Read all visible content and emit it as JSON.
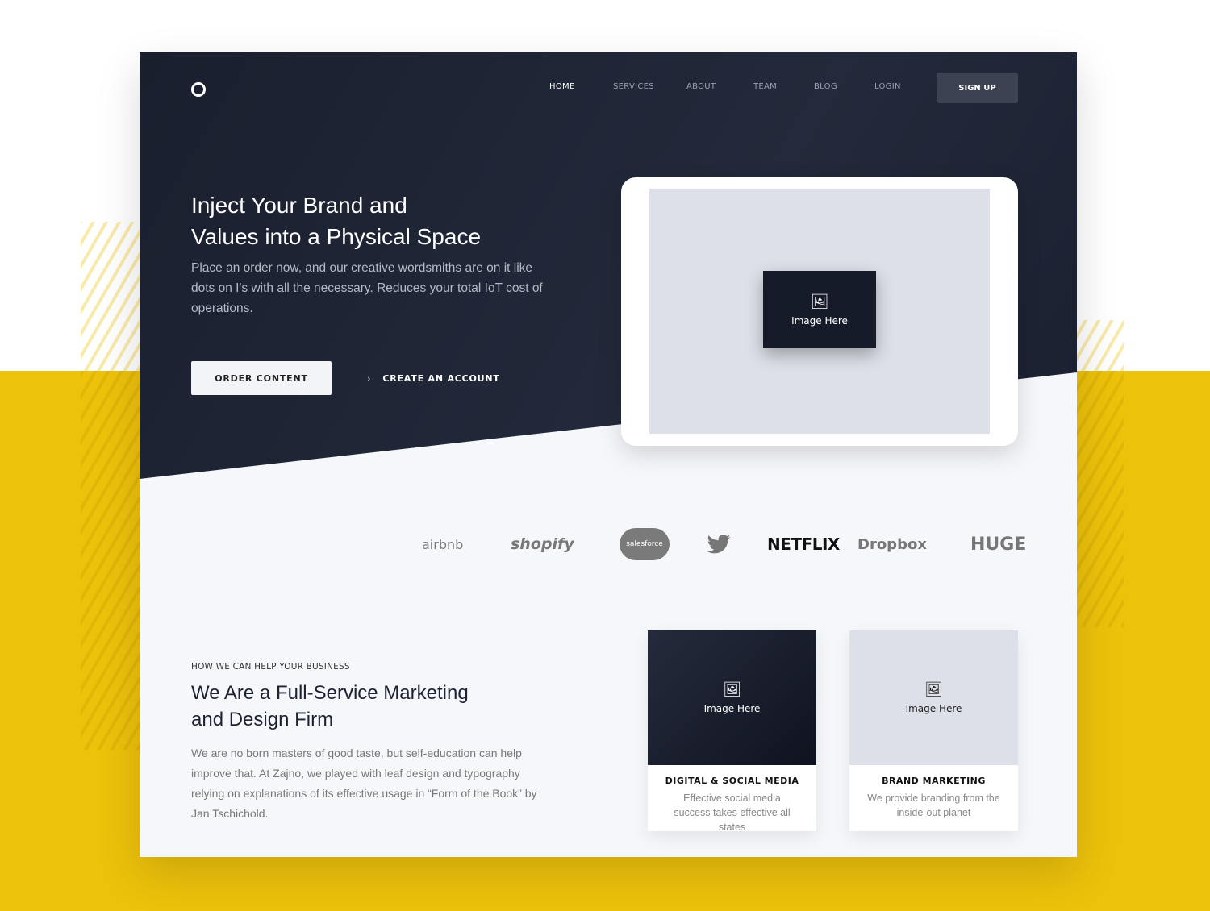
{
  "nav": {
    "items": [
      "HOME",
      "SERVICES",
      "ABOUT",
      "TEAM",
      "BLOG",
      "LOGIN"
    ],
    "signup": "SIGN UP"
  },
  "hero": {
    "title_line1": "Inject Your Brand and",
    "title_line2": "Values into a Physical Space",
    "lead": "Place an order now, and our creative wordsmiths are on it like dots on I's with all the necessary. Reduces your total IoT cost of operations.",
    "order_button": "ORDER CONTENT",
    "create_account": "CREATE AN ACCOUNT",
    "image_label": "Image Here"
  },
  "logos": [
    "airbnb",
    "shopify",
    "salesforce",
    "twitter",
    "NETFLIX",
    "Dropbox",
    "HUGE"
  ],
  "services": {
    "eyebrow": "HOW WE CAN HELP YOUR BUSINESS",
    "title_line1": "We Are a Full-Service Marketing",
    "title_line2": "and Design Firm",
    "body": "We are no born masters of good taste, but self-education can help improve that. At Zajno, we played with leaf design and typography relying on explanations of its effective usage in “Form of the Book” by Jan Tschichold.",
    "cards": [
      {
        "image_label": "Image Here",
        "title": "DIGITAL & SOCIAL MEDIA",
        "desc": "Effective social media success takes effective all states"
      },
      {
        "image_label": "Image Here",
        "title": "BRAND MARKETING",
        "desc": "We provide branding from the inside-out planet"
      }
    ]
  },
  "colors": {
    "accent": "#EDC20B",
    "dark": "#1c2233"
  }
}
